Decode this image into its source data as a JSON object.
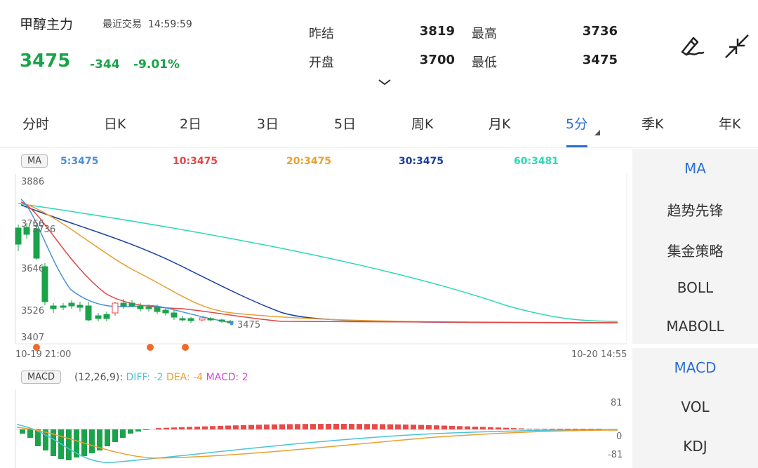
{
  "header": {
    "name": "甲醇主力",
    "trade_label": "最近交易",
    "trade_time": "14:59:59",
    "price": "3475",
    "change": "-344",
    "change_pct": "-9.01%",
    "stats": [
      {
        "label": "昨结",
        "value": "3819"
      },
      {
        "label": "开盘",
        "value": "3700"
      },
      {
        "label": "最高",
        "value": "3736"
      },
      {
        "label": "最低",
        "value": "3475"
      }
    ],
    "draw_icon": "pen-draw-icon",
    "collapse_icon": "collapse-arrows-icon",
    "expand_icon": "chevron-down-icon"
  },
  "tabs": [
    {
      "label": "分时"
    },
    {
      "label": "日K"
    },
    {
      "label": "2日"
    },
    {
      "label": "3日"
    },
    {
      "label": "5日"
    },
    {
      "label": "周K"
    },
    {
      "label": "月K"
    },
    {
      "label": "5分",
      "active": true
    },
    {
      "label": "季K"
    },
    {
      "label": "年K"
    }
  ],
  "main_chart": {
    "indicator_badge": "MA",
    "ma_labels": [
      {
        "text": "5:3475",
        "color": "#4a90d9"
      },
      {
        "text": "10:3475",
        "color": "#e04848"
      },
      {
        "text": "20:3475",
        "color": "#e8a030"
      },
      {
        "text": "30:3475",
        "color": "#1a3fa0"
      },
      {
        "text": "60:3481",
        "color": "#2ed8b8"
      }
    ],
    "y_ticks": [
      "3886",
      "3766",
      "3646",
      "3526",
      "3407"
    ],
    "high_mark": "3736",
    "last_mark": "3475",
    "x_start": "10-19 21:00",
    "x_end": "10-20 14:55"
  },
  "macd_chart": {
    "badge": "MACD",
    "params": "(12,26,9):",
    "diff": "DIFF: -2",
    "dea": "DEA: -4",
    "macd": "MACD: 2",
    "y_top": "81",
    "y_mid": "0",
    "y_bot": "-81"
  },
  "side_panel": {
    "top_items": [
      "MA",
      "趋势先锋",
      "集金策略",
      "BOLL",
      "MABOLL"
    ],
    "bottom_items": [
      "MACD",
      "VOL",
      "KDJ"
    ]
  },
  "colors": {
    "up": "#e84a4a",
    "down": "#1aa34a",
    "accent": "#2b6fd6",
    "ma5": "#4a90d9",
    "ma10": "#e04848",
    "ma20": "#e8a030",
    "ma30": "#1a3fa0",
    "ma60": "#2ed8b8",
    "diff": "#4ac3d9",
    "dea": "#e8a030",
    "macd": "#d04bd0"
  }
}
